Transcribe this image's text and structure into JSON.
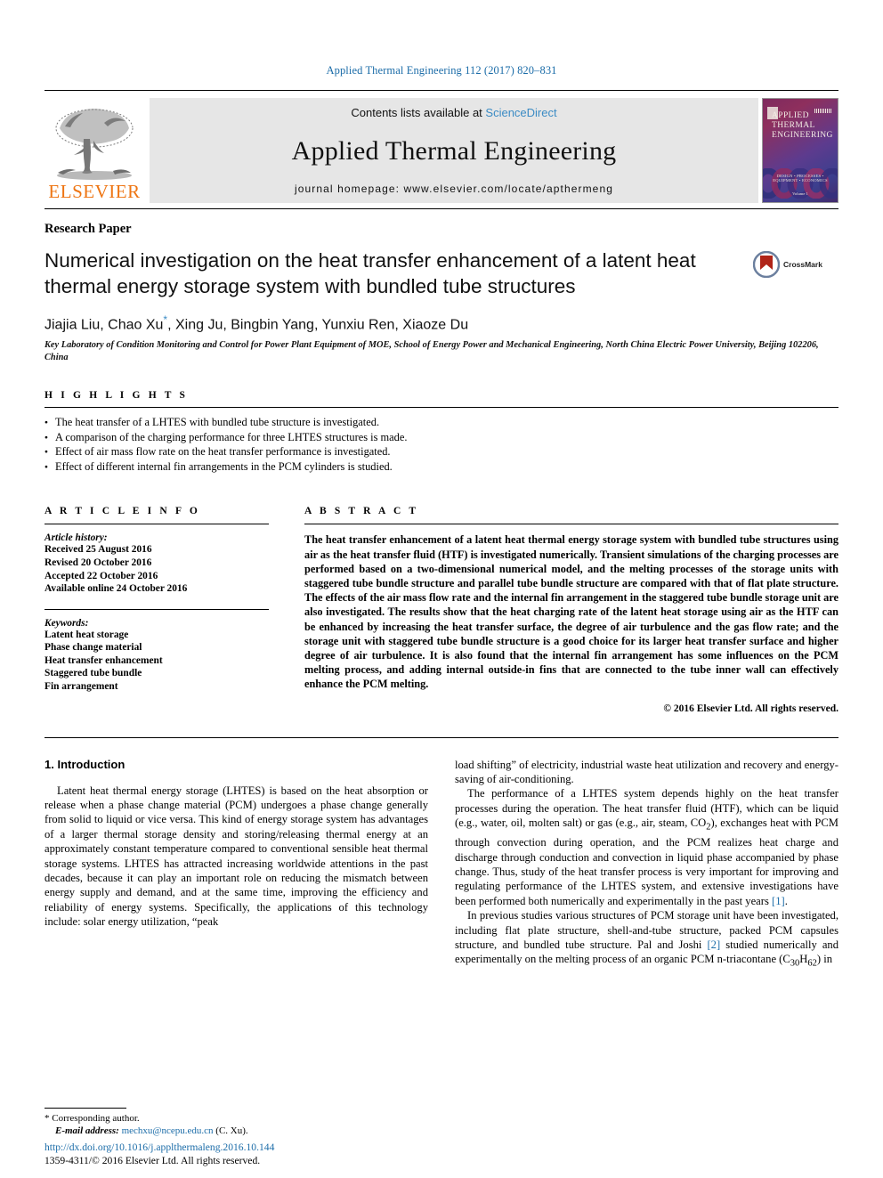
{
  "running_head": "Applied Thermal Engineering 112 (2017) 820–831",
  "banner": {
    "publisher_logo_text": "ELSEVIER",
    "contents_prefix": "Contents lists available at ",
    "contents_link": "ScienceDirect",
    "journal_title": "Applied Thermal Engineering",
    "homepage": "journal homepage: www.elsevier.com/locate/apthermeng",
    "cover": {
      "line1": "APPLIED",
      "line2": "THERMAL",
      "line3": "ENGINEERING",
      "footer": "DESIGN • PROCESSES • EQUIPMENT • ECONOMICS",
      "volume": "Volume 1"
    }
  },
  "article": {
    "type_label": "Research Paper",
    "title": "Numerical investigation on the heat transfer enhancement of a latent heat thermal energy storage system with bundled tube structures",
    "crossmark_label": "CrossMark",
    "authors": "Jiajia Liu, Chao Xu",
    "authors_rest": ", Xing Ju, Bingbin Yang, Yunxiu Ren, Xiaoze Du",
    "corresponding_marker": "*",
    "affiliation": "Key Laboratory of Condition Monitoring and Control for Power Plant Equipment of MOE, School of Energy Power and Mechanical Engineering, North China Electric Power University, Beijing 102206, China"
  },
  "highlights": {
    "heading": "H I G H L I G H T S",
    "items": [
      "The heat transfer of a LHTES with bundled tube structure is investigated.",
      "A comparison of the charging performance for three LHTES structures is made.",
      "Effect of air mass flow rate on the heat transfer performance is investigated.",
      "Effect of different internal fin arrangements in the PCM cylinders is studied."
    ]
  },
  "article_info": {
    "heading": "A R T I C L E    I N F O",
    "history_label": "Article history:",
    "history": [
      "Received 25 August 2016",
      "Revised 20 October 2016",
      "Accepted 22 October 2016",
      "Available online 24 October 2016"
    ],
    "keywords_label": "Keywords:",
    "keywords": [
      "Latent heat storage",
      "Phase change material",
      "Heat transfer enhancement",
      "Staggered tube bundle",
      "Fin arrangement"
    ]
  },
  "abstract": {
    "heading": "A B S T R A C T",
    "text": "The heat transfer enhancement of a latent heat thermal energy storage system with bundled tube structures using air as the heat transfer fluid (HTF) is investigated numerically. Transient simulations of the charging processes are performed based on a two-dimensional numerical model, and the melting processes of the storage units with staggered tube bundle structure and parallel tube bundle structure are compared with that of flat plate structure. The effects of the air mass flow rate and the internal fin arrangement in the staggered tube bundle storage unit are also investigated. The results show that the heat charging rate of the latent heat storage using air as the HTF can be enhanced by increasing the heat transfer surface, the degree of air turbulence and the gas flow rate; and the storage unit with staggered tube bundle structure is a good choice for its larger heat transfer surface and higher degree of air turbulence. It is also found that the internal fin arrangement has some influences on the PCM melting process, and adding internal outside-in fins that are connected to the tube inner wall can effectively enhance the PCM melting.",
    "copyright": "© 2016 Elsevier Ltd. All rights reserved."
  },
  "body": {
    "section_heading": "1. Introduction",
    "left_para_1": "Latent heat thermal energy storage (LHTES) is based on the heat absorption or release when a phase change material (PCM) undergoes a phase change generally from solid to liquid or vice versa. This kind of energy storage system has advantages of a larger thermal storage density and storing/releasing thermal energy at an approximately constant temperature compared to conventional sensible heat thermal storage systems. LHTES has attracted increasing worldwide attentions in the past decades, because it can play an important role on reducing the mismatch between energy supply and demand, and at the same time, improving the efficiency and reliability of energy systems. Specifically, the applications of this technology include: solar energy utilization, “peak",
    "right_para_1_cont": "load shifting” of electricity, industrial waste heat utilization and recovery and energy-saving of air-conditioning.",
    "right_para_2_a": "The performance of a LHTES system depends highly on the heat transfer processes during the operation. The heat transfer fluid (HTF), which can be liquid (e.g., water, oil, molten salt) or gas (e.g., air, steam, CO",
    "right_para_2_sub": "2",
    "right_para_2_b": "), exchanges heat with PCM through convection during operation, and the PCM realizes heat charge and discharge through conduction and convection in liquid phase accompanied by phase change. Thus, study of the heat transfer process is very important for improving and regulating performance of the LHTES system, and extensive investigations have been performed both numerically and experimentally in the past years ",
    "right_para_2_ref": "[1]",
    "right_para_2_end": ".",
    "right_para_3_a": "In previous studies various structures of PCM storage unit have been investigated, including flat plate structure, shell-and-tube structure, packed PCM capsules structure, and bundled tube structure. Pal and Joshi ",
    "right_para_3_ref": "[2]",
    "right_para_3_b": " studied numerically and experimentally on the melting process of an organic PCM n-triacontane (C",
    "right_para_3_sub1": "30",
    "right_para_3_mid": "H",
    "right_para_3_sub2": "62",
    "right_para_3_end": ") in"
  },
  "footnote": {
    "star": "*",
    "corresponding": "Corresponding author.",
    "email_label": "E-mail address:",
    "email": "mechxu@ncepu.edu.cn",
    "email_suffix": "(C. Xu)."
  },
  "footer": {
    "doi": "http://dx.doi.org/10.1016/j.applthermaleng.2016.10.144",
    "issn": "1359-4311/© 2016 Elsevier Ltd. All rights reserved."
  },
  "colors": {
    "link": "#1b6ca8",
    "sciencedirect": "#3b8bc4",
    "elsevier_orange": "#ee7513",
    "banner_bg": "#e6e6e6"
  }
}
